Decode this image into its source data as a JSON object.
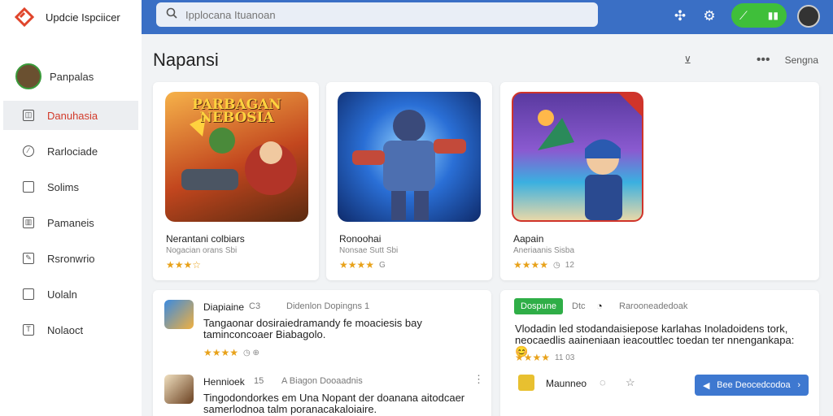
{
  "app": {
    "name": "Updcie Ispciicer"
  },
  "search": {
    "placeholder": "Ipplocana Ituanoan"
  },
  "sidebar": {
    "user_name": "Panpalas",
    "items": [
      {
        "label": "Danuhasia",
        "active": true
      },
      {
        "label": "Rarlociade"
      },
      {
        "label": "Solims"
      },
      {
        "label": "Pamaneis"
      },
      {
        "label": "Rsronwrio"
      },
      {
        "label": "Uolaln"
      },
      {
        "label": "Nolaoct"
      }
    ]
  },
  "page": {
    "title": "Napansi"
  },
  "header_actions": {
    "sort_label": "Sengna"
  },
  "games": [
    {
      "title": "Nerantani colbiars",
      "subtitle": "Nogacian orans Sbi",
      "thumb_text": "PARBAGAN NEBOSIA"
    },
    {
      "title": "Ronoohai",
      "subtitle": "Nonsae Sutt Sbi",
      "meta": "G"
    },
    {
      "title": "Aapain",
      "subtitle": "Aneriaanis Sisba",
      "meta": "12"
    }
  ],
  "reviews": [
    {
      "name": "Diapiaine",
      "count": "C3",
      "meta": "Didenlon Dopingns 1",
      "text": "Tangaonar dosiraiedramandy fe moaciesis bay taminconcoaer Biabagolo."
    },
    {
      "name": "Hennioek",
      "count": "15",
      "meta": "A Biagon Dooaadnis",
      "text": "Tingodondorkes em Una Nopant der doanana aitodcaer samerlodnoa talm poranacakaloiaire."
    }
  ],
  "featured": {
    "badge": "Dospune",
    "label": "Dtc",
    "meta": "Rarooneadedoak",
    "text": "Vlodadin led stodandaisiepose karlahas Inoladoidens tork, neocaedlis aaineniaan ieacouttlec toedan ter nnengankapa: 😊",
    "rating_meta": "11 03",
    "author": "Maunneo",
    "button_label": "Bee Deocedcodoa"
  }
}
